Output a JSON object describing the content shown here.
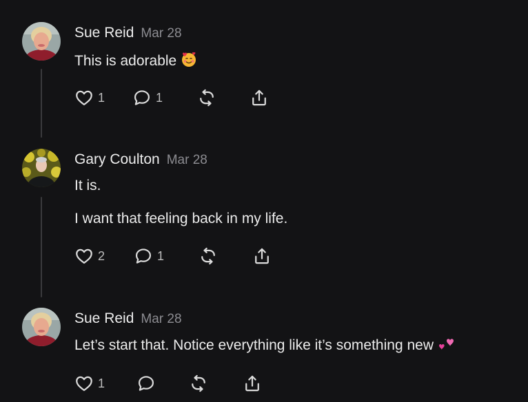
{
  "posts": [
    {
      "author": "Sue Reid",
      "date": "Mar 28",
      "lines": [
        "This is adorable"
      ],
      "emoji": "smiling-face-with-hearts-icon",
      "likes": "1",
      "replies": "1"
    },
    {
      "author": "Gary Coulton",
      "date": "Mar 28",
      "lines": [
        "It is.",
        "I want that feeling back in my life."
      ],
      "likes": "2",
      "replies": "1"
    },
    {
      "author": "Sue Reid",
      "date": "Mar 28",
      "lines": [
        "Let’s start that. Notice everything like it’s something new"
      ],
      "emoji": "two-hearts-icon",
      "likes": "1",
      "replies": ""
    }
  ],
  "icons": {
    "like": "heart-icon",
    "reply": "comment-icon",
    "repost": "repost-icon",
    "share": "share-icon"
  },
  "colors": {
    "background": "#131315",
    "text": "#ececec",
    "muted": "#8c8c91",
    "thread_line": "#3a3a3d"
  }
}
